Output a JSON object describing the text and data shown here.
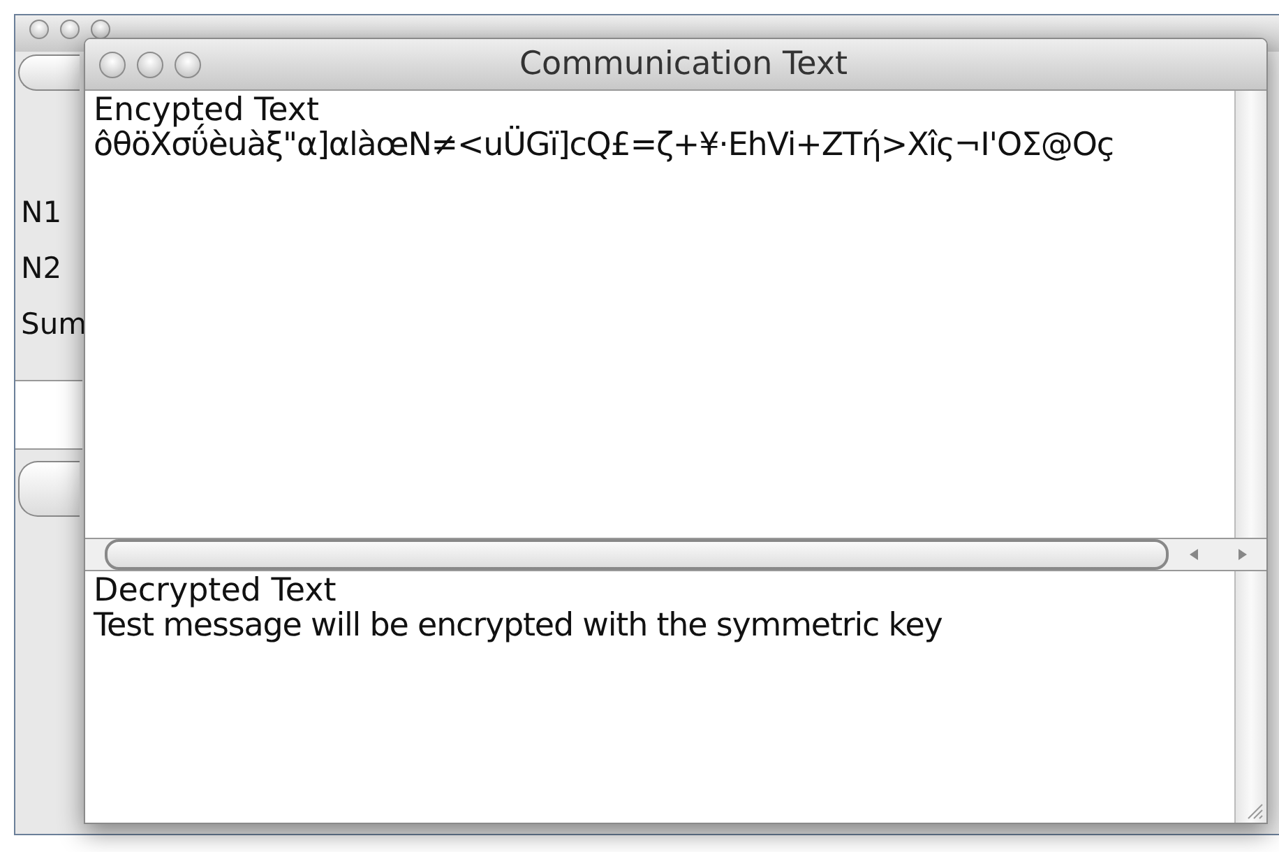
{
  "back_window": {
    "labels": [
      "N1",
      "N2",
      "Sum"
    ]
  },
  "front_window": {
    "title": "Communication Text",
    "encrypted_pane": {
      "heading": "Encypted Text",
      "text": "ôθöXσΰèuàξ\"α]αlàœN≠<uÜGï]cQ£=ζ+¥·EhVi+ZTή>Xîς¬I'OΣ@Oç"
    },
    "decrypted_pane": {
      "heading": "Decrypted Text",
      "text": "Test message will be encrypted with the symmetric key"
    }
  }
}
